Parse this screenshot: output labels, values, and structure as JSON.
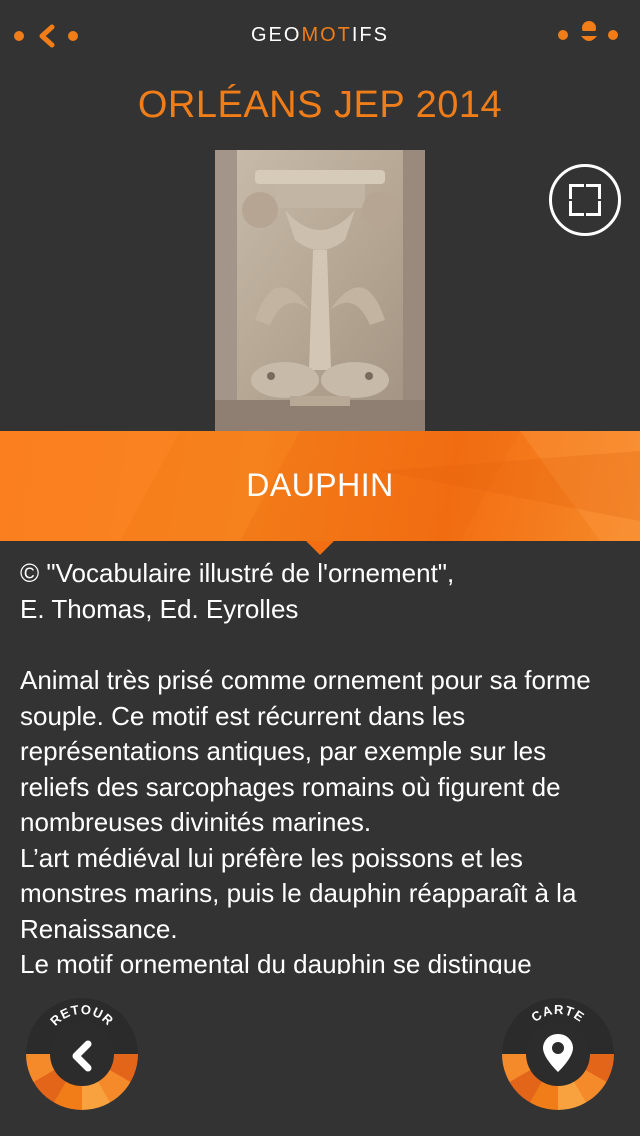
{
  "header": {
    "logo_part1": "GEO",
    "logo_part2": "MOT",
    "logo_part3": "IFS",
    "accent_color": "#f07d18",
    "left_icon": "back-chevron-dots-icon",
    "right_icon": "geolocation-dots-icon"
  },
  "page_title": "ORLÉANS JEP 2014",
  "image": {
    "icon": "expand-icon"
  },
  "band": {
    "title": "DAUPHIN"
  },
  "content": {
    "credit_line1": "© \"Vocabulaire illustré de l'ornement\",",
    "credit_line2": "E. Thomas, Ed. Eyrolles",
    "para1": "Animal très prisé comme ornement pour sa forme souple. Ce motif est récurrent dans les représentations antiques, par exemple sur les reliefs des sarcophages romains où figurent de nombreuses divinités marines.",
    "para2": "L’art médiéval lui préfère les poissons et les monstres marins, puis le dauphin réapparaît à la Renaissance.",
    "para3": "Le motif ornemental du dauphin se distingue"
  },
  "nav": {
    "back_label": "RETOUR",
    "map_label": "CARTE",
    "back_icon": "chevron-left-icon",
    "map_icon": "map-pin-icon"
  }
}
